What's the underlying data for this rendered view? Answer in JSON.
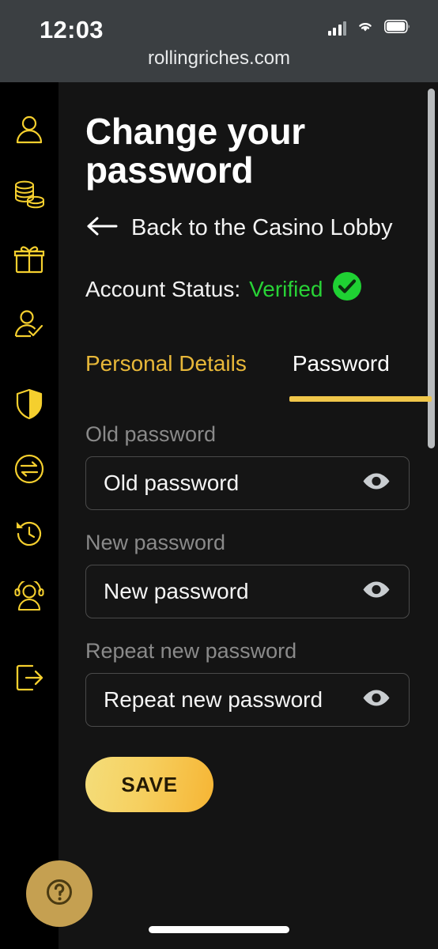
{
  "status_bar": {
    "time": "12:03",
    "signal_icon": "cellular-signal-icon",
    "wifi_icon": "wifi-icon",
    "battery_icon": "battery-icon",
    "url": "rollingriches.com"
  },
  "sidebar": {
    "items": [
      {
        "icon": "user-account-icon",
        "name": "sidebar-item-account"
      },
      {
        "icon": "coins-stack-icon",
        "name": "sidebar-item-cashier"
      },
      {
        "icon": "gift-box-icon",
        "name": "sidebar-item-bonuses"
      },
      {
        "icon": "user-verified-icon",
        "name": "sidebar-item-verification"
      },
      {
        "icon": "shield-icon",
        "name": "sidebar-item-responsible-gaming"
      },
      {
        "icon": "transfer-arrows-icon",
        "name": "sidebar-item-transactions"
      },
      {
        "icon": "history-clock-icon",
        "name": "sidebar-item-history"
      },
      {
        "icon": "headset-support-icon",
        "name": "sidebar-item-support"
      },
      {
        "icon": "logout-icon",
        "name": "sidebar-item-logout"
      }
    ]
  },
  "main": {
    "title": "Change your password",
    "back_link": {
      "label": "Back to the Casino Lobby",
      "icon": "arrow-left-icon"
    },
    "account_status": {
      "label": "Account Status:",
      "value": "Verified",
      "icon": "check-circle-icon",
      "color": "#28d236"
    },
    "tabs": [
      {
        "label": "Personal Details",
        "active": false
      },
      {
        "label": "Password",
        "active": true
      }
    ],
    "fields": [
      {
        "label": "Old password",
        "placeholder": "Old password",
        "value": "Old password",
        "toggle_icon": "eye-icon"
      },
      {
        "label": "New password",
        "placeholder": "New password",
        "value": "New password",
        "toggle_icon": "eye-icon"
      },
      {
        "label": "Repeat new password",
        "placeholder": "Repeat new password",
        "value": "Repeat new password",
        "toggle_icon": "eye-icon"
      }
    ],
    "save_label": "SAVE"
  },
  "help_button": {
    "icon": "question-mark-icon"
  },
  "colors": {
    "accent_gold": "#f0c64a",
    "tab_inactive_gold": "#e8b839",
    "verified_green": "#28d236",
    "sidebar_bg": "#000000",
    "main_bg": "#141414",
    "statusbar_bg": "#3b3f42"
  }
}
